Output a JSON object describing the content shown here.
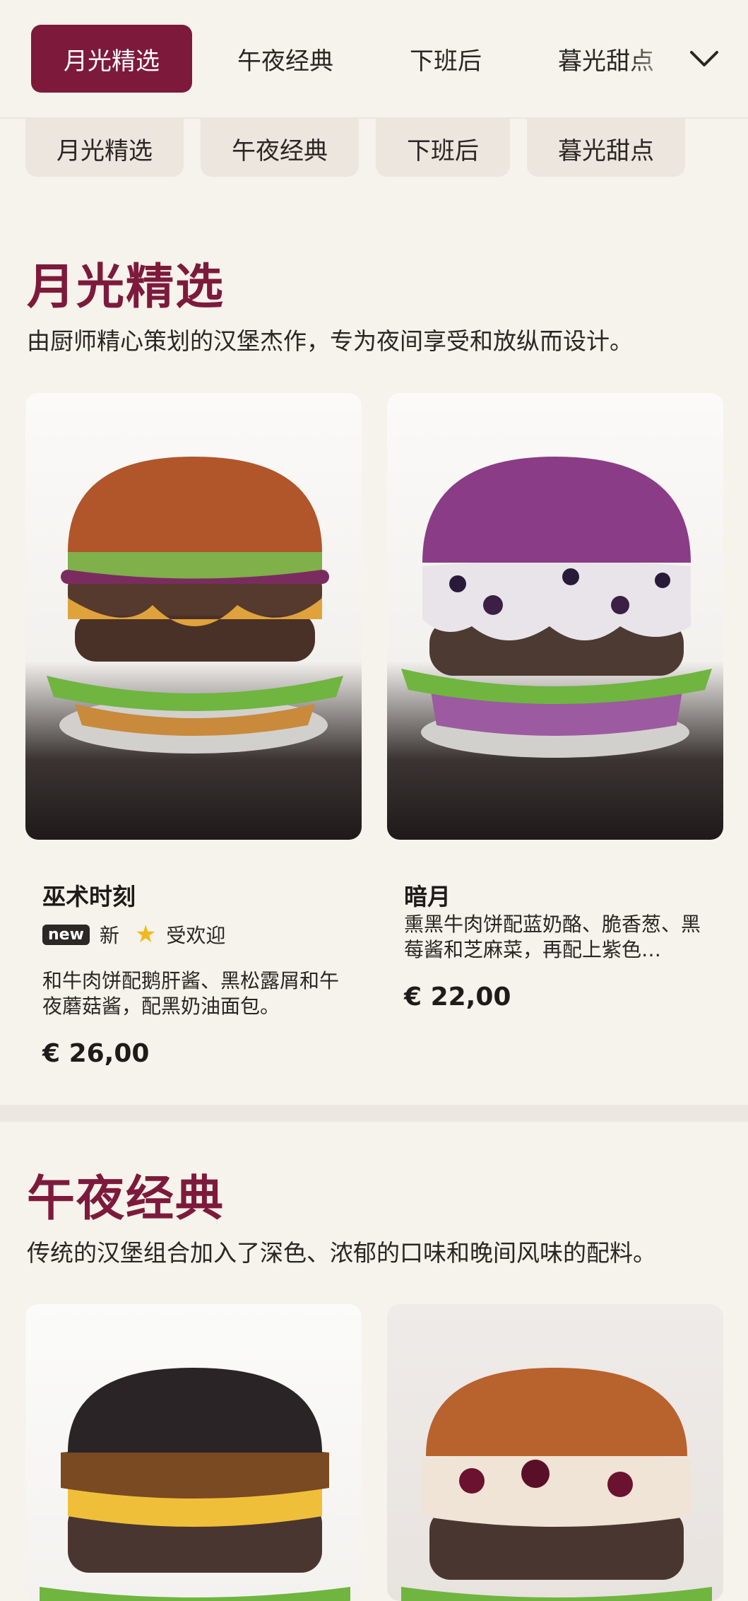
{
  "tabs": [
    {
      "label": "月光精选",
      "active": true
    },
    {
      "label": "午夜经典",
      "active": false
    },
    {
      "label": "下班后",
      "active": false
    },
    {
      "label": "暮光甜点",
      "active": false
    }
  ],
  "chips": [
    "月光精选",
    "午夜经典",
    "下班后",
    "暮光甜点"
  ],
  "sections": [
    {
      "title": "月光精选",
      "description": "由厨师精心策划的汉堡杰作，专为夜间享受和放纵而设计。",
      "items": [
        {
          "name": "巫术时刻",
          "badge_new": "new",
          "badge_new_text": "新",
          "badge_popular": "受欢迎",
          "description": "和牛肉饼配鹅肝酱、黑松露屑和午夜蘑菇酱，配黑奶油面包。",
          "price": "€ 26,00",
          "bun_color": "#b0562a"
        },
        {
          "name": "暗月",
          "description": "熏黑牛肉饼配蓝奶酪、脆香葱、黑莓酱和芝麻菜，再配上紫色…",
          "price": "€ 22,00",
          "bun_color": "#8a3c86"
        }
      ]
    },
    {
      "title": "午夜经典",
      "description": "传统的汉堡组合加入了深色、浓郁的口味和晚间风味的配料。",
      "items": [
        {
          "bun_color": "#2a2426"
        },
        {
          "bun_color": "#b8622e"
        }
      ]
    }
  ],
  "colors": {
    "accent": "#7d1a3c",
    "background": "#f6f2ec"
  }
}
